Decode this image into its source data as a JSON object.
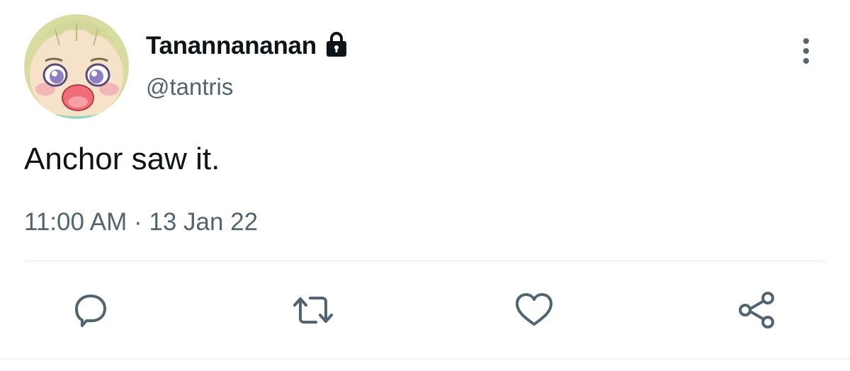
{
  "author": {
    "display_name": "Tanannananan",
    "handle": "@tantris",
    "avatar_icon": "anime-baby-face-avatar",
    "protected_icon": "lock-icon"
  },
  "tweet": {
    "text": "Anchor saw it.",
    "timestamp": "11:00 AM · 13 Jan 22"
  },
  "actions": [
    {
      "name": "reply",
      "icon": "reply-icon"
    },
    {
      "name": "retweet",
      "icon": "retweet-icon"
    },
    {
      "name": "like",
      "icon": "heart-icon"
    },
    {
      "name": "share",
      "icon": "share-icon"
    }
  ],
  "colors": {
    "text_primary": "#0f1419",
    "text_secondary": "#536471",
    "divider": "#eff3f4"
  }
}
